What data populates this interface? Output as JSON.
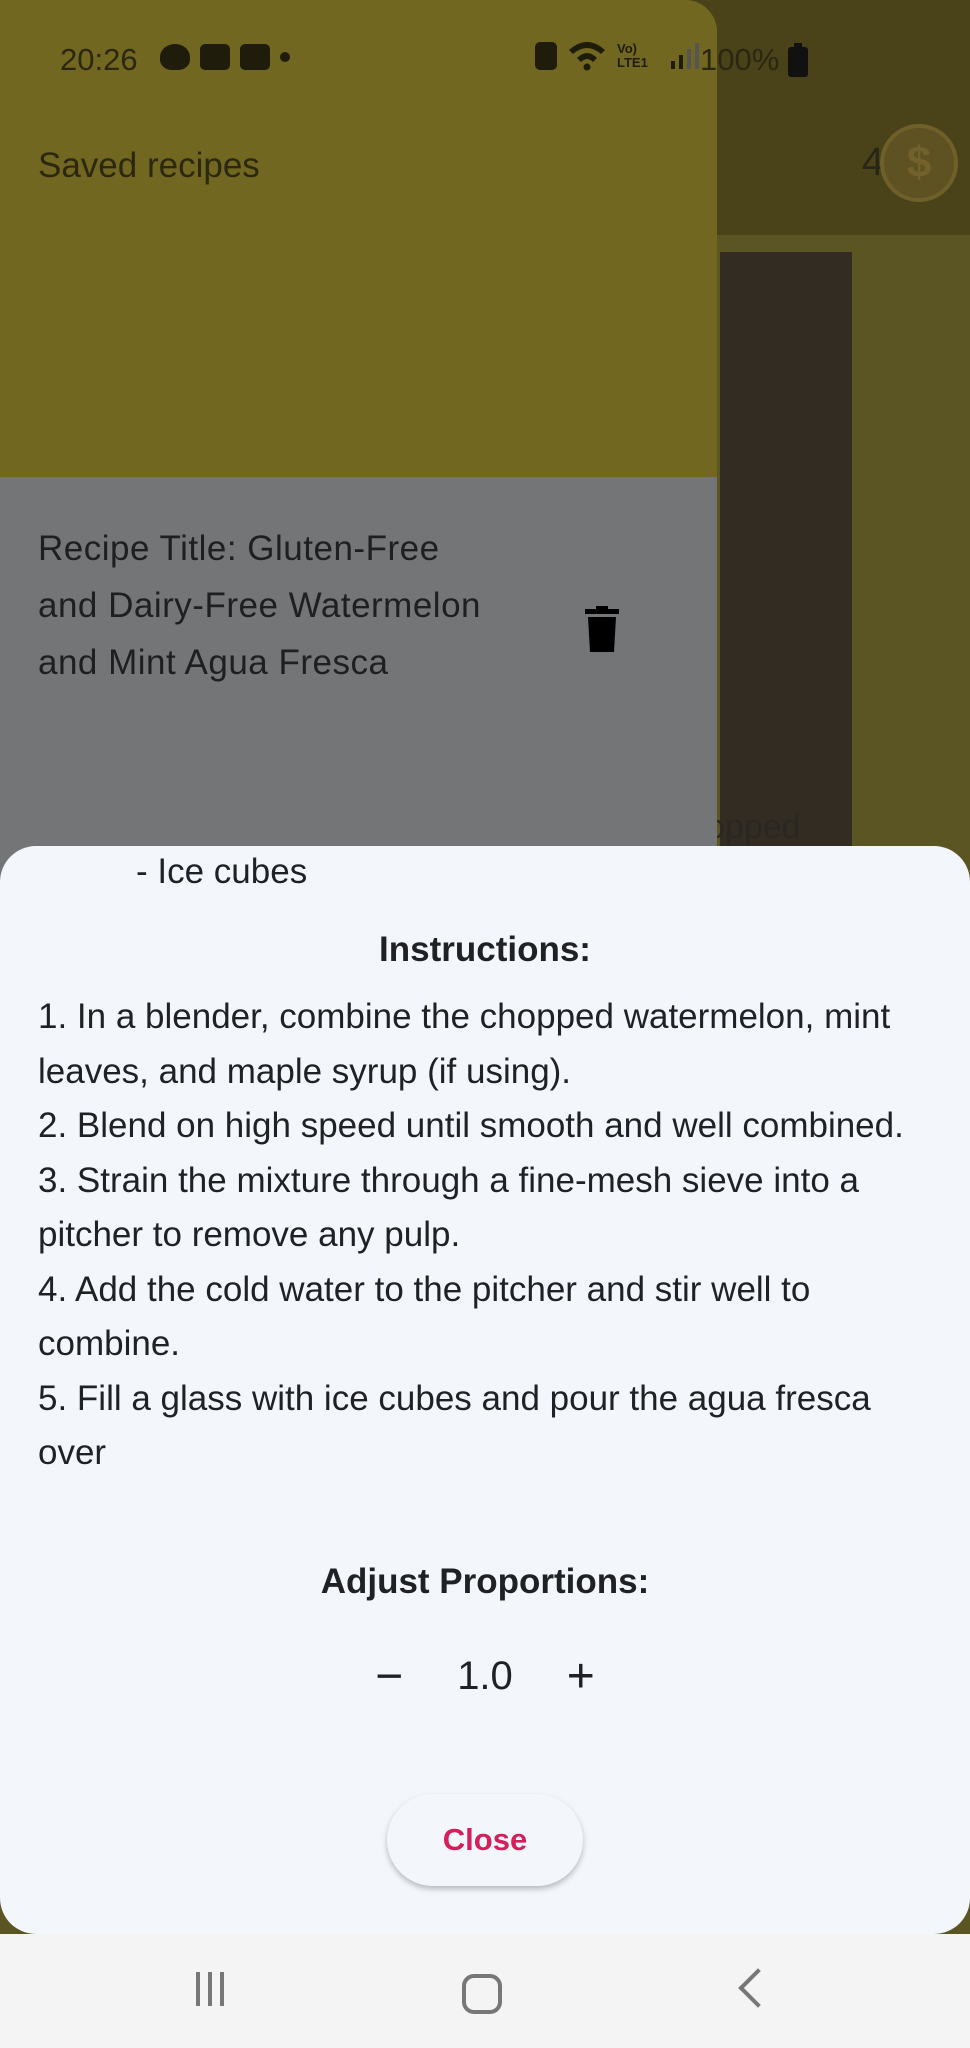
{
  "status_bar": {
    "time": "20:26",
    "battery_percent": "100%",
    "network_label": "Vo) LTE1"
  },
  "app": {
    "coin_count": "4",
    "coin_symbol": "$",
    "background_peek_text": "opped"
  },
  "drawer": {
    "title": "Saved recipes",
    "recipes": [
      {
        "title": "Recipe Title: Gluten-Free and Dairy-Free Watermelon and Mint Agua Fresca"
      }
    ]
  },
  "sheet": {
    "ingredient_tail": "- Ice cubes",
    "instructions_heading": "Instructions:",
    "instructions": [
      "1. In a blender, combine the chopped watermelon, mint leaves, and maple syrup (if using).",
      "2. Blend on high speed until smooth and well combined.",
      "3. Strain the mixture through a fine-mesh sieve into a pitcher to remove any pulp.",
      "4. Add the cold water to the pitcher and stir well to combine.",
      "5. Fill a glass with ice cubes and pour the agua fresca over"
    ],
    "adjust_heading": "Adjust Proportions:",
    "proportion_value": "1.0",
    "minus_label": "−",
    "plus_label": "+",
    "close_label": "Close"
  },
  "colors": {
    "accent": "#d61f5a",
    "drawer_header": "#726721",
    "sheet_bg": "#f3f7fb"
  }
}
